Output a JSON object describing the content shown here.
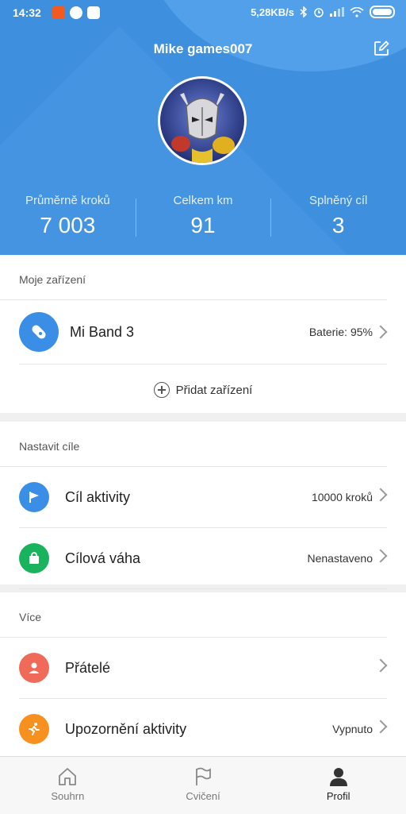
{
  "status_bar": {
    "time": "14:32",
    "speed": "5,28KB/s"
  },
  "profile": {
    "username": "Mike games007",
    "stats": [
      {
        "label": "Průměrně kroků",
        "value": "7 003"
      },
      {
        "label": "Celkem km",
        "value": "91"
      },
      {
        "label": "Splněný cíl",
        "value": "3"
      }
    ]
  },
  "devices": {
    "title": "Moje zařízení",
    "device_name": "Mi Band 3",
    "battery": "Baterie: 95%",
    "add_label": "Přidat zařízení"
  },
  "goals": {
    "title": "Nastavit cíle",
    "items": [
      {
        "label": "Cíl aktivity",
        "value": "10000 kroků"
      },
      {
        "label": "Cílová váha",
        "value": "Nenastaveno"
      }
    ]
  },
  "more": {
    "title": "Více",
    "items": [
      {
        "label": "Přátelé",
        "value": ""
      },
      {
        "label": "Upozornění aktivity",
        "value": "Vypnuto"
      }
    ]
  },
  "tabs": [
    {
      "label": "Souhrn",
      "icon": "home-icon"
    },
    {
      "label": "Cvičení",
      "icon": "flag-icon"
    },
    {
      "label": "Profil",
      "icon": "person-icon"
    }
  ],
  "colors": {
    "header_blue": "#3f8fdf",
    "device_blue": "#3a8ee6",
    "goal_blue": "#3a8ee6",
    "weight_green": "#19b35d",
    "friends_red": "#f06a5a",
    "alert_orange": "#f7901e"
  }
}
